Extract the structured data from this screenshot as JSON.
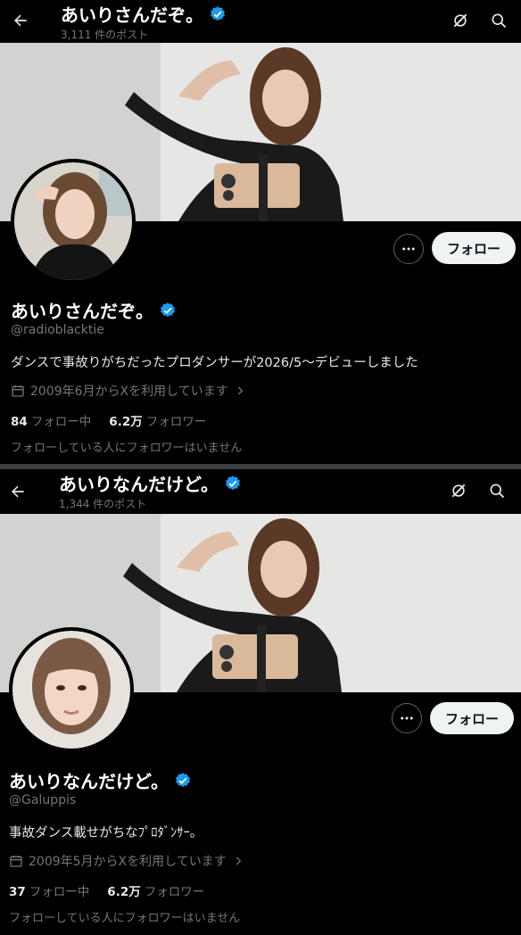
{
  "profiles": [
    {
      "header_name": "あいりさんだぞ。",
      "post_count": "3,111 件のポスト",
      "name": "あいりさんだぞ。",
      "handle": "@radioblacktie",
      "bio": "ダンスで事故りがちだったプロダンサーが2026/5～デビューしました",
      "joined": "2009年6月からXを利用しています",
      "following_count": "84",
      "following_label": "フォロー中",
      "followers_count": "6.2万",
      "followers_label": "フォロワー",
      "follow_label": "フォロー",
      "mutual_note": "フォローしている人にフォロワーはいません"
    },
    {
      "header_name": "あいりなんだけど。",
      "post_count": "1,344 件のポスト",
      "name": "あいりなんだけど。",
      "handle": "@Galuppis",
      "bio": "事故ダンス載せがちなﾌﾟﾛﾀﾞﾝｻｰ。",
      "joined": "2009年5月からXを利用しています",
      "following_count": "37",
      "following_label": "フォロー中",
      "followers_count": "6.2万",
      "followers_label": "フォロワー",
      "follow_label": "フォロー",
      "mutual_note": "フォローしている人にフォロワーはいません"
    }
  ],
  "icons": [
    "back-arrow-icon",
    "grok-icon",
    "search-icon",
    "verified-badge-icon",
    "more-dots-icon",
    "calendar-icon",
    "chevron-right-icon"
  ],
  "colors": {
    "background": "#000000",
    "verified": "#1d9bf0",
    "secondary_text": "#71767b",
    "follow_button": "#eff3f4"
  }
}
